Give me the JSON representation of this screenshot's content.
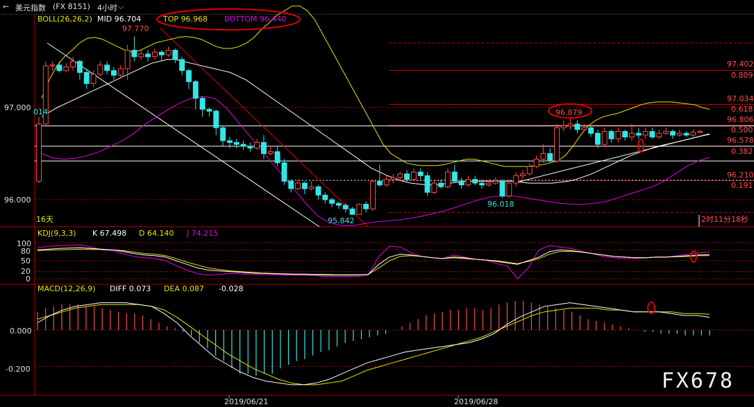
{
  "header": {
    "title": "美元指数",
    "code": "(FX 8151)",
    "period": "4小时"
  },
  "boll": {
    "name": "BOLL(26,26,2)",
    "mid": "MID 96.704",
    "top": "TOP 96.968",
    "bottom": "BOTTOM 96.440"
  },
  "kdj": {
    "name": "KDJ(9,3,3)",
    "k": "K 67.498",
    "d": "D 64.140",
    "j": "J 74.215",
    "ticks": [
      "100",
      "80",
      "50",
      "20",
      "0"
    ]
  },
  "macd": {
    "name": "MACD(12,26,9)",
    "diff": "DIFF 0.073",
    "dea": "DEA 0.087",
    "macd": "-0.028",
    "ticks": [
      "0.000",
      "-0.200"
    ]
  },
  "footer": {
    "days": "16天",
    "countdown": "2时11分18秒",
    "watermark": "FX678"
  },
  "chart_data": {
    "type": "candlestick",
    "price_ticks": [
      "97.000",
      "96.000"
    ],
    "date_ticks": [
      "2019/06/21",
      "2019/06/28"
    ],
    "left_edge_label": "014",
    "annotations": {
      "high": "97.770",
      "low": "95.842",
      "swing_low": "96.018",
      "swing_high": "96.879"
    },
    "fibonacci": {
      "prices": [
        "97.402",
        "97.034",
        "96.806",
        "96.578",
        "96.210"
      ],
      "ratios": [
        "0.809",
        "0.618",
        "0.500",
        "0.382",
        "0.191"
      ]
    },
    "candles": [
      [
        96.2,
        96.82,
        96.9,
        96.18
      ],
      [
        96.82,
        97.45,
        97.5,
        96.8
      ],
      [
        97.45,
        97.46,
        97.5,
        97.4
      ],
      [
        97.46,
        97.4,
        97.5,
        97.38
      ],
      [
        97.4,
        97.44,
        97.48,
        97.38
      ],
      [
        97.44,
        97.5,
        97.55,
        97.4
      ],
      [
        97.5,
        97.38,
        97.52,
        97.3
      ],
      [
        97.38,
        97.26,
        97.42,
        97.2
      ],
      [
        97.26,
        97.36,
        97.4,
        97.22
      ],
      [
        97.36,
        97.46,
        97.5,
        97.34
      ],
      [
        97.46,
        97.4,
        97.5,
        97.36
      ],
      [
        97.4,
        97.35,
        97.44,
        97.3
      ],
      [
        97.35,
        97.42,
        97.46,
        97.32
      ],
      [
        97.42,
        97.62,
        97.68,
        97.3
      ],
      [
        97.62,
        97.55,
        97.77,
        97.5
      ],
      [
        97.55,
        97.58,
        97.62,
        97.52
      ],
      [
        97.58,
        97.55,
        97.62,
        97.5
      ],
      [
        97.55,
        97.6,
        97.64,
        97.52
      ],
      [
        97.6,
        97.57,
        97.62,
        97.5
      ],
      [
        97.57,
        97.62,
        97.66,
        97.55
      ],
      [
        97.62,
        97.52,
        97.64,
        97.48
      ],
      [
        97.52,
        97.4,
        97.55,
        97.35
      ],
      [
        97.4,
        97.28,
        97.42,
        97.2
      ],
      [
        97.28,
        97.1,
        97.3,
        96.98
      ],
      [
        97.1,
        96.98,
        97.12,
        96.9
      ],
      [
        96.98,
        96.96,
        97.0,
        96.9
      ],
      [
        96.96,
        96.78,
        96.98,
        96.7
      ],
      [
        96.78,
        96.64,
        96.8,
        96.58
      ],
      [
        96.64,
        96.62,
        96.68,
        96.56
      ],
      [
        96.62,
        96.6,
        96.66,
        96.56
      ],
      [
        96.6,
        96.58,
        96.64,
        96.54
      ],
      [
        96.58,
        96.56,
        96.62,
        96.52
      ],
      [
        96.56,
        96.62,
        96.66,
        96.54
      ],
      [
        96.62,
        96.5,
        96.7,
        96.44
      ],
      [
        96.5,
        96.52,
        96.58,
        96.48
      ],
      [
        96.52,
        96.4,
        96.58,
        96.36
      ],
      [
        96.4,
        96.2,
        96.44,
        96.16
      ],
      [
        96.2,
        96.12,
        96.22,
        96.08
      ],
      [
        96.12,
        96.18,
        96.22,
        96.1
      ],
      [
        96.18,
        96.12,
        96.2,
        96.06
      ],
      [
        96.12,
        96.14,
        96.2,
        96.1
      ],
      [
        96.14,
        96.05,
        96.16,
        96.0
      ],
      [
        96.05,
        96.0,
        96.08,
        95.96
      ],
      [
        96.0,
        95.96,
        96.02,
        95.92
      ],
      [
        95.96,
        95.94,
        95.98,
        95.9
      ],
      [
        95.94,
        95.9,
        95.96,
        95.86
      ],
      [
        95.9,
        95.84,
        95.92,
        95.84
      ],
      [
        95.84,
        95.95,
        95.96,
        95.84
      ],
      [
        95.95,
        95.9,
        95.98,
        95.86
      ],
      [
        95.9,
        96.2,
        96.22,
        95.88
      ],
      [
        96.2,
        96.16,
        96.38,
        96.14
      ],
      [
        96.16,
        96.22,
        96.26,
        96.14
      ],
      [
        96.22,
        96.24,
        96.28,
        96.18
      ],
      [
        96.24,
        96.28,
        96.3,
        96.2
      ],
      [
        96.28,
        96.22,
        96.32,
        96.2
      ],
      [
        96.22,
        96.3,
        96.34,
        96.2
      ],
      [
        96.3,
        96.26,
        96.34,
        96.22
      ],
      [
        96.26,
        96.08,
        96.3,
        96.04
      ],
      [
        96.08,
        96.18,
        96.2,
        96.06
      ],
      [
        96.18,
        96.14,
        96.22,
        96.12
      ],
      [
        96.14,
        96.3,
        96.34,
        96.12
      ],
      [
        96.3,
        96.2,
        96.38,
        96.18
      ],
      [
        96.2,
        96.16,
        96.24,
        96.12
      ],
      [
        96.16,
        96.22,
        96.26,
        96.14
      ],
      [
        96.22,
        96.18,
        96.26,
        96.16
      ],
      [
        96.18,
        96.16,
        96.22,
        96.12
      ],
      [
        96.16,
        96.18,
        96.22,
        96.14
      ],
      [
        96.18,
        96.2,
        96.24,
        96.16
      ],
      [
        96.2,
        96.04,
        96.22,
        96.02
      ],
      [
        96.04,
        96.18,
        96.22,
        96.02
      ],
      [
        96.18,
        96.26,
        96.3,
        96.14
      ],
      [
        96.26,
        96.28,
        96.32,
        96.22
      ],
      [
        96.28,
        96.36,
        96.4,
        96.26
      ],
      [
        96.36,
        96.44,
        96.48,
        96.34
      ],
      [
        96.44,
        96.5,
        96.6,
        96.4
      ],
      [
        96.5,
        96.42,
        96.56,
        96.4
      ],
      [
        96.42,
        96.78,
        96.82,
        96.4
      ],
      [
        96.78,
        96.8,
        96.86,
        96.74
      ],
      [
        96.8,
        96.82,
        96.88,
        96.76
      ],
      [
        96.82,
        96.76,
        96.86,
        96.72
      ],
      [
        96.76,
        96.78,
        96.82,
        96.74
      ],
      [
        96.78,
        96.72,
        96.8,
        96.68
      ],
      [
        96.72,
        96.6,
        96.76,
        96.56
      ],
      [
        96.6,
        96.74,
        96.78,
        96.58
      ],
      [
        96.74,
        96.66,
        96.76,
        96.62
      ],
      [
        96.66,
        96.74,
        96.78,
        96.62
      ],
      [
        96.74,
        96.68,
        96.76,
        96.64
      ],
      [
        96.68,
        96.72,
        96.82,
        96.64
      ],
      [
        96.72,
        96.7,
        96.78,
        96.66
      ],
      [
        96.7,
        96.74,
        96.78,
        96.66
      ],
      [
        96.74,
        96.68,
        96.78,
        96.66
      ],
      [
        96.68,
        96.72,
        96.76,
        96.66
      ],
      [
        96.72,
        96.74,
        96.78,
        96.7
      ],
      [
        96.74,
        96.7,
        96.76,
        96.66
      ],
      [
        96.7,
        96.72,
        96.76,
        96.68
      ],
      [
        96.72,
        96.7,
        96.74,
        96.68
      ],
      [
        96.7,
        96.73,
        96.76,
        96.68
      ],
      [
        96.73,
        96.74,
        96.76,
        96.72
      ]
    ],
    "boll_upper": [
      97.1,
      97.3,
      97.45,
      97.55,
      97.62,
      97.7,
      97.75,
      97.76,
      97.74,
      97.7,
      97.66,
      97.62,
      97.6,
      97.62,
      97.66,
      97.7,
      97.72,
      97.74,
      97.76,
      97.77,
      97.76,
      97.74,
      97.7,
      97.66,
      97.64,
      97.64,
      97.66,
      97.7,
      97.76,
      97.85,
      97.92,
      98.0,
      98.05,
      98.1,
      98.1,
      98.05,
      97.95,
      97.8,
      97.65,
      97.5,
      97.35,
      97.2,
      97.05,
      96.9,
      96.75,
      96.6,
      96.5,
      96.45,
      96.4,
      96.38,
      96.37,
      96.37,
      96.37,
      96.38,
      96.4,
      96.42,
      96.44,
      96.44,
      96.42,
      96.4,
      96.38,
      96.36,
      96.36,
      96.36,
      96.36,
      96.37,
      96.38,
      96.4,
      96.42,
      96.48,
      96.58,
      96.7,
      96.8,
      96.86,
      96.9,
      96.92,
      96.94,
      96.97,
      97.0,
      97.03,
      97.05,
      97.06,
      97.06,
      97.06,
      97.05,
      97.04,
      97.03,
      97.0,
      96.98
    ],
    "boll_mid": [
      96.9,
      96.95,
      97.0,
      97.04,
      97.08,
      97.12,
      97.16,
      97.2,
      97.24,
      97.28,
      97.32,
      97.36,
      97.4,
      97.44,
      97.48,
      97.5,
      97.52,
      97.52,
      97.5,
      97.48,
      97.46,
      97.44,
      97.42,
      97.4,
      97.38,
      97.34,
      97.3,
      97.24,
      97.18,
      97.12,
      97.06,
      97.0,
      96.94,
      96.88,
      96.82,
      96.76,
      96.7,
      96.64,
      96.58,
      96.52,
      96.46,
      96.4,
      96.34,
      96.3,
      96.26,
      96.23,
      96.2,
      96.18,
      96.17,
      96.16,
      96.16,
      96.17,
      96.18,
      96.19,
      96.2,
      96.2,
      96.2,
      96.2,
      96.2,
      96.2,
      96.2,
      96.19,
      96.18,
      96.18,
      96.18,
      96.18,
      96.19,
      96.2,
      96.22,
      96.25,
      96.28,
      96.32,
      96.36,
      96.4,
      96.44,
      96.48,
      96.51,
      96.54,
      96.57,
      96.59,
      96.61,
      96.63,
      96.65,
      96.67,
      96.69,
      96.71
    ],
    "boll_lower": [
      96.5,
      96.45,
      96.44,
      96.45,
      96.48,
      96.52,
      96.58,
      96.64,
      96.72,
      96.82,
      96.9,
      96.98,
      97.05,
      97.1,
      97.12,
      97.1,
      97.0,
      96.85,
      96.7,
      96.55,
      96.4,
      96.25,
      96.1,
      95.95,
      95.82,
      95.75,
      95.72,
      95.72,
      95.74,
      95.76,
      95.77,
      95.78,
      95.8,
      95.82,
      95.85,
      95.88,
      95.92,
      95.96,
      96.0,
      96.03,
      96.04,
      96.04,
      96.02,
      96.0,
      95.98,
      95.96,
      95.95,
      95.95,
      95.96,
      95.98,
      96.02,
      96.06,
      96.1,
      96.14,
      96.2,
      96.28,
      96.36,
      96.42,
      96.46
    ],
    "kdj_k": [
      80,
      82,
      84,
      85,
      86,
      84,
      82,
      80,
      76,
      70,
      66,
      64,
      60,
      50,
      40,
      30,
      24,
      22,
      20,
      18,
      16,
      15,
      14,
      13,
      12,
      12,
      11,
      10,
      10,
      10,
      10,
      12,
      40,
      60,
      68,
      66,
      62,
      58,
      56,
      60,
      58,
      54,
      52,
      48,
      44,
      40,
      50,
      60,
      75,
      80,
      78,
      74,
      70,
      66,
      62,
      60,
      58,
      58,
      60,
      60,
      62,
      64,
      66,
      67
    ],
    "kdj_d": [
      78,
      79,
      80,
      81,
      82,
      82,
      81,
      80,
      78,
      74,
      70,
      68,
      64,
      56,
      46,
      38,
      30,
      26,
      22,
      20,
      18,
      16,
      15,
      14,
      13,
      13,
      12,
      12,
      11,
      11,
      11,
      12,
      30,
      50,
      62,
      64,
      62,
      58,
      56,
      58,
      56,
      54,
      52,
      50,
      46,
      42,
      48,
      56,
      68,
      76,
      76,
      74,
      70,
      66,
      62,
      60,
      58,
      58,
      60,
      60,
      61,
      62,
      64,
      64
    ],
    "kdj_j": [
      86,
      90,
      92,
      93,
      94,
      88,
      80,
      78,
      70,
      62,
      58,
      56,
      50,
      36,
      24,
      14,
      10,
      12,
      15,
      14,
      12,
      12,
      11,
      10,
      10,
      9,
      9,
      6,
      6,
      6,
      6,
      10,
      62,
      90,
      88,
      72,
      62,
      58,
      56,
      66,
      60,
      54,
      52,
      42,
      36,
      0,
      30,
      80,
      92,
      88,
      84,
      76,
      70,
      62,
      58,
      56,
      56,
      58,
      60,
      60,
      64,
      68,
      72,
      74
    ],
    "macd_diff": [
      0.04,
      0.08,
      0.11,
      0.13,
      0.14,
      0.15,
      0.15,
      0.15,
      0.14,
      0.13,
      0.09,
      0.04,
      -0.03,
      -0.09,
      -0.15,
      -0.19,
      -0.23,
      -0.26,
      -0.28,
      -0.29,
      -0.3,
      -0.3,
      -0.29,
      -0.27,
      -0.24,
      -0.21,
      -0.18,
      -0.16,
      -0.14,
      -0.12,
      -0.11,
      -0.1,
      -0.09,
      -0.08,
      -0.07,
      -0.05,
      -0.02,
      0.03,
      0.07,
      0.1,
      0.13,
      0.14,
      0.15,
      0.14,
      0.13,
      0.12,
      0.11,
      0.1,
      0.1,
      0.1,
      0.09,
      0.08,
      0.08,
      0.07
    ],
    "macd_dea": [
      0.06,
      0.08,
      0.1,
      0.12,
      0.13,
      0.14,
      0.14,
      0.14,
      0.14,
      0.13,
      0.11,
      0.07,
      0.02,
      -0.03,
      -0.08,
      -0.13,
      -0.17,
      -0.21,
      -0.24,
      -0.27,
      -0.29,
      -0.3,
      -0.3,
      -0.29,
      -0.28,
      -0.25,
      -0.22,
      -0.2,
      -0.18,
      -0.16,
      -0.14,
      -0.12,
      -0.1,
      -0.08,
      -0.06,
      -0.04,
      -0.01,
      0.02,
      0.05,
      0.08,
      0.1,
      0.11,
      0.12,
      0.12,
      0.12,
      0.11,
      0.11,
      0.1,
      0.1,
      0.1,
      0.1,
      0.09,
      0.09,
      0.087
    ],
    "macd_hist": [
      0.1,
      0.12,
      0.13,
      0.14,
      0.14,
      0.14,
      0.13,
      0.13,
      0.12,
      0.11,
      0.1,
      0.09,
      0.09,
      0.08,
      0.06,
      0.04,
      0.02,
      0.01,
      -0.01,
      -0.03,
      -0.07,
      -0.1,
      -0.14,
      -0.17,
      -0.21,
      -0.24,
      -0.24,
      -0.25,
      -0.24,
      -0.24,
      -0.21,
      -0.19,
      -0.17,
      -0.16,
      -0.14,
      -0.12,
      -0.11,
      -0.09,
      -0.07,
      -0.06,
      -0.05,
      -0.04,
      -0.03,
      -0.02,
      0.0,
      0.02,
      0.04,
      0.06,
      0.08,
      0.09,
      0.1,
      0.11,
      0.11,
      0.12,
      0.12,
      0.11,
      0.12,
      0.14,
      0.15,
      0.16,
      0.16,
      0.15,
      0.14,
      0.13,
      0.12,
      0.11,
      0.1,
      0.08,
      0.06,
      0.05,
      0.04,
      0.03,
      0.02,
      0.01,
      0.0,
      -0.01,
      -0.01,
      -0.02,
      -0.02,
      -0.02,
      -0.03,
      -0.03,
      -0.03,
      -0.03
    ],
    "colors": {
      "up": "#ff4d4d",
      "down": "#33e6e6",
      "mid": "#ffffff",
      "upper": "#e6e600",
      "lower": "#e600e6",
      "grid": "#b30000",
      "fib": "#cc0000",
      "k": "#ffffff",
      "d": "#e6e600",
      "j": "#e600e6"
    }
  }
}
